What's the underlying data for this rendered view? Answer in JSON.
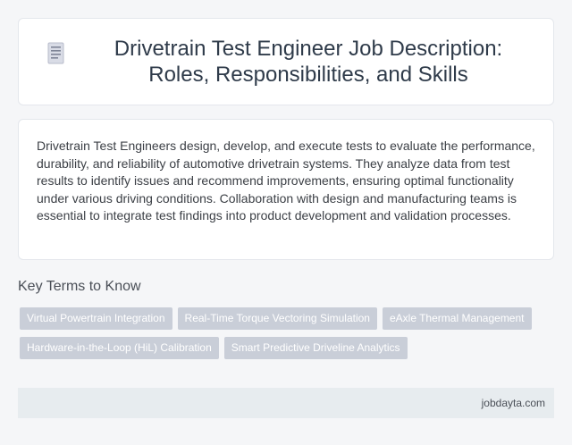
{
  "header": {
    "icon": "document-icon",
    "title": "Drivetrain Test Engineer Job Description: Roles, Responsibilities, and Skills"
  },
  "description": {
    "text": "Drivetrain Test Engineers design, develop, and execute tests to evaluate the performance, durability, and reliability of automotive drivetrain systems. They analyze data from test results to identify issues and recommend improvements, ensuring optimal functionality under various driving conditions. Collaboration with design and manufacturing teams is essential to integrate test findings into product development and validation processes."
  },
  "key_terms": {
    "heading": "Key Terms to Know",
    "row1": [
      "Virtual Powertrain Integration",
      "Real-Time Torque Vectoring Simulation",
      "eAxle Thermal Management"
    ],
    "row2": [
      "Hardware-in-the-Loop (HiL) Calibration",
      "Smart Predictive Driveline Analytics"
    ]
  },
  "footer": {
    "site": "jobdayta.com"
  },
  "colors": {
    "tag_background": "#c9ced8",
    "footer_background": "#e7ecef"
  }
}
